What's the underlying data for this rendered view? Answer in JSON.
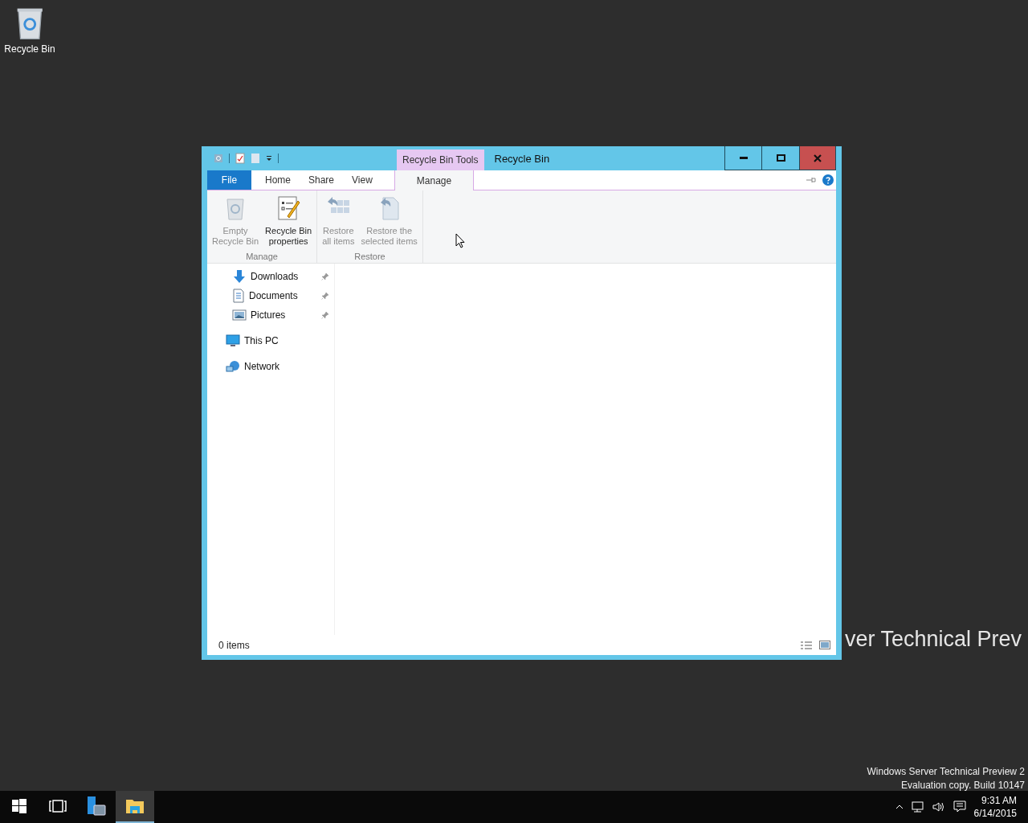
{
  "desktop": {
    "icons": [
      {
        "label": "Recycle Bin"
      }
    ],
    "wallpaper_text": "ver Technical Prev",
    "watermark_lines": [
      "Windows Server Technical Preview 2",
      "Evaluation copy. Build 10147"
    ]
  },
  "window": {
    "title": "Recycle Bin",
    "context_tab_group": "Recycle Bin Tools",
    "tabs": [
      {
        "label": "File",
        "selected": false,
        "kind": "file"
      },
      {
        "label": "Home",
        "selected": false,
        "kind": "normal"
      },
      {
        "label": "Share",
        "selected": false,
        "kind": "normal"
      },
      {
        "label": "View",
        "selected": false,
        "kind": "normal"
      },
      {
        "label": "Manage",
        "selected": true,
        "kind": "context"
      }
    ],
    "ribbon_groups": [
      {
        "label": "Manage",
        "buttons": [
          {
            "label": "Empty\nRecycle Bin",
            "disabled": true
          },
          {
            "label": "Recycle Bin\nproperties",
            "disabled": false
          }
        ]
      },
      {
        "label": "Restore",
        "buttons": [
          {
            "label": "Restore\nall items",
            "disabled": true
          },
          {
            "label": "Restore the\nselected items",
            "disabled": true
          }
        ]
      }
    ],
    "quick_access": [
      {
        "label": "Downloads",
        "pinned": true
      },
      {
        "label": "Documents",
        "pinned": true
      },
      {
        "label": "Pictures",
        "pinned": true
      }
    ],
    "locations": [
      {
        "label": "This PC"
      },
      {
        "label": "Network"
      }
    ],
    "status_bar": {
      "text": "0 items"
    }
  },
  "taskbar": {
    "apps": [
      {
        "selected": false
      },
      {
        "selected": false
      },
      {
        "selected": false
      },
      {
        "selected": true
      }
    ],
    "clock": {
      "time": "9:31 AM",
      "date": "6/14/2015"
    }
  }
}
